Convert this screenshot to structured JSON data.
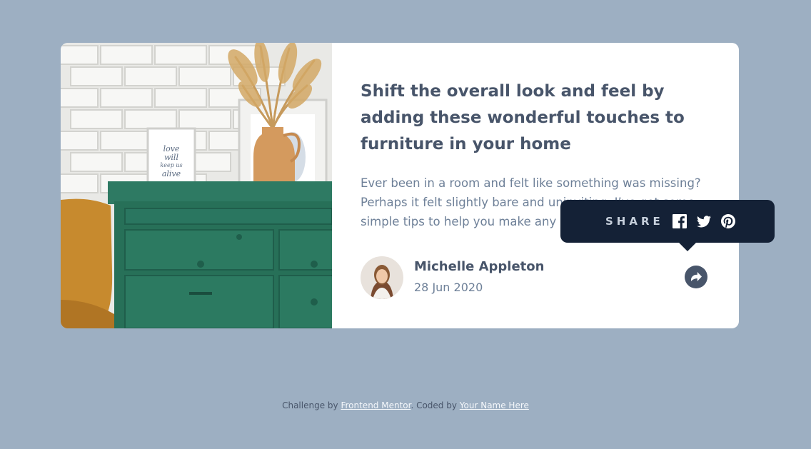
{
  "article": {
    "title": "Shift the overall look and feel by adding these wonderful touches to furniture in your home",
    "excerpt": "Ever been in a room and felt like something was missing? Perhaps it felt slightly bare and uninviting. I’ve got some simple tips to help you make any room feel complete.",
    "author_name": "Michelle Appleton",
    "author_date": "28 Jun 2020"
  },
  "share": {
    "label": "SHARE",
    "icons": [
      "facebook-icon",
      "twitter-icon",
      "pinterest-icon"
    ],
    "button_icon": "share-arrow-icon"
  },
  "footer": {
    "prefix": "Challenge by",
    "link1": "Frontend Mentor",
    "middle": ". Coded by",
    "link2": "Your Name Here"
  },
  "colors": {
    "page_bg": "#9dafc2",
    "card_bg": "#ffffff",
    "heading": "#48556a",
    "body_text": "#6e8098",
    "tooltip_bg": "#142136"
  }
}
